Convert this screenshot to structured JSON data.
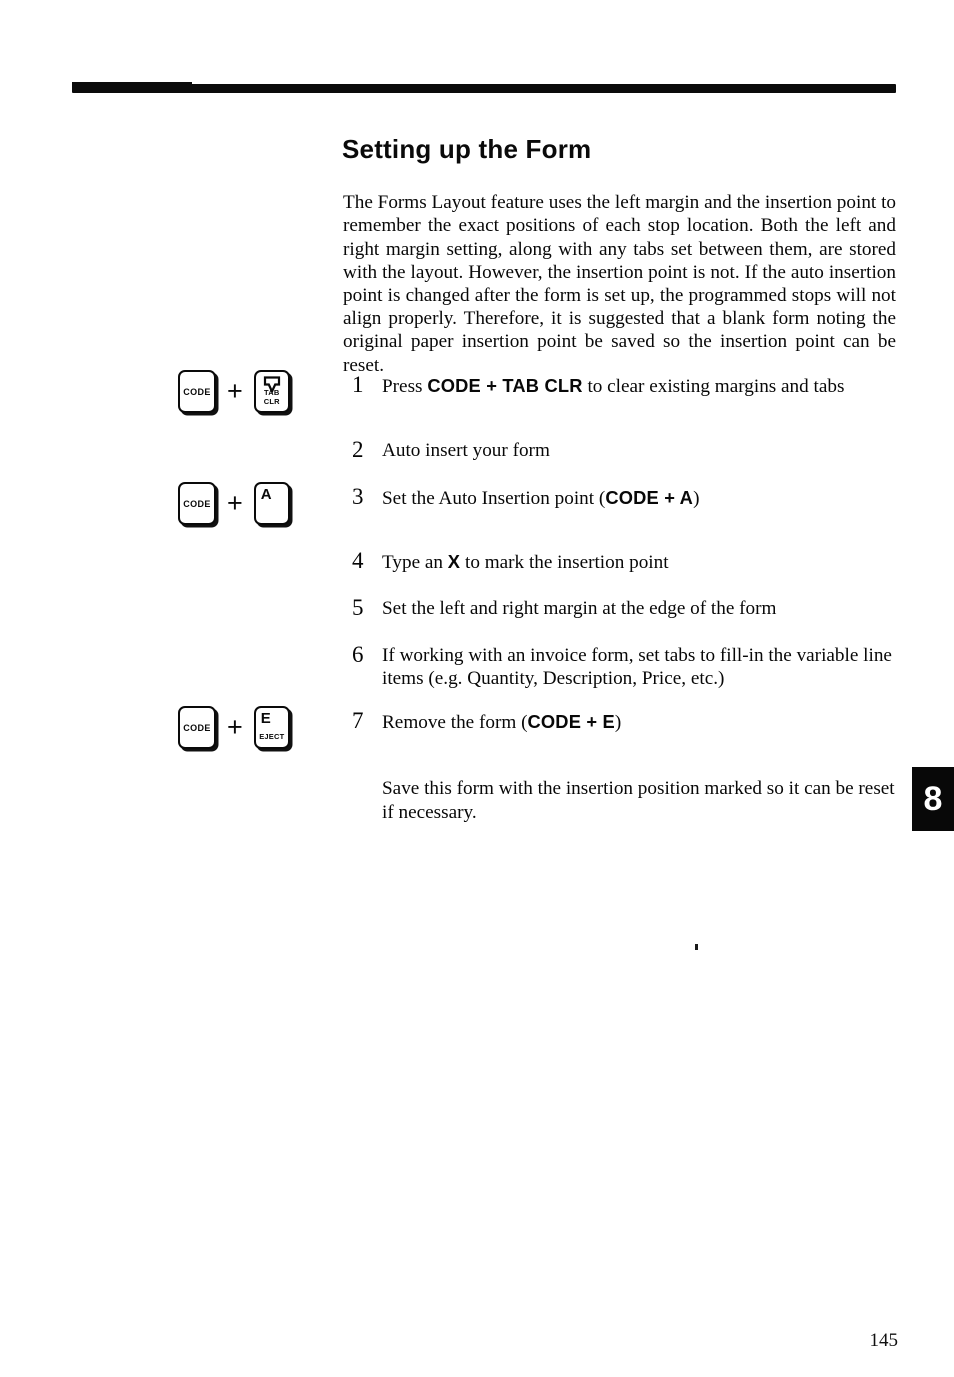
{
  "document": {
    "heading": "Setting up the Form",
    "page_number": "145",
    "chapter_tab": "8",
    "intro_paragraph": "The Forms Layout feature uses the left margin and the insertion point to remember the exact positions of each stop location. Both the left and right margin setting, along with any tabs set between them, are stored with the layout. However, the insertion point is not. If the auto insertion point is changed after the form is set up, the programmed stops will not align properly. Therefore, it is suggested that a blank form noting the original paper insertion point be saved so the insertion point can be reset.",
    "closing_note": "Save this form with the insertion position marked so it can be reset if necessary."
  },
  "steps": [
    {
      "number": "1",
      "text_before": "Press ",
      "key_combo": "CODE + TAB CLR",
      "text_after": " to clear existing margins and tabs"
    },
    {
      "number": "2",
      "text_before": "Auto insert your form",
      "key_combo": "",
      "text_after": ""
    },
    {
      "number": "3",
      "text_before": "Set the Auto Insertion point (",
      "key_combo": "CODE + A",
      "text_after": ")"
    },
    {
      "number": "4",
      "text_before": "Type an ",
      "key_combo": "X",
      "text_after": " to mark the insertion point"
    },
    {
      "number": "5",
      "text_before": "Set the left and right margin at the edge of the form",
      "key_combo": "",
      "text_after": ""
    },
    {
      "number": "6",
      "text_before": "If working with an invoice form, set tabs to fill-in the variable line items (e.g. Quantity, Description, Price, etc.)",
      "key_combo": "",
      "text_after": ""
    },
    {
      "number": "7",
      "text_before": "Remove the form (",
      "key_combo": "CODE + E",
      "text_after": ")"
    }
  ],
  "key_graphics": [
    {
      "for_step": "1",
      "first_key": "CODE",
      "separator": "+",
      "second_key_label": "TAB CLR",
      "second_key_icon": "tab-clear-down-arrow-icon"
    },
    {
      "for_step": "3",
      "first_key": "CODE",
      "separator": "+",
      "second_key_label": "A",
      "second_key_icon": ""
    },
    {
      "for_step": "7",
      "first_key": "CODE",
      "separator": "+",
      "second_key_label": "E",
      "second_key_sub": "EJECT",
      "second_key_icon": ""
    }
  ],
  "colors": {
    "ink": "#080808",
    "paper": "#ffffff",
    "tab_background": "#080808",
    "tab_text": "#ffffff"
  }
}
